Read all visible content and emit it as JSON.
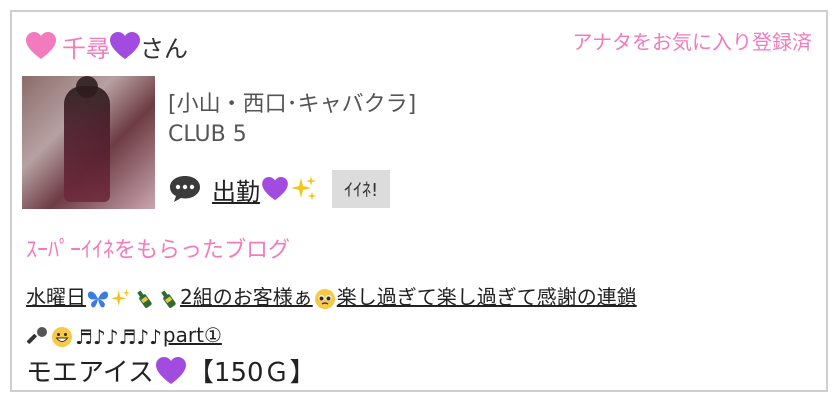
{
  "header": {
    "name": "千尋",
    "honorific": "さん",
    "favorite_status": "アナタをお気に入り登録済"
  },
  "profile": {
    "area": "[小山・西口･キャバクラ]",
    "club": "CLUB 5"
  },
  "post": {
    "title": "出勤",
    "iine_label": "ｲｲﾈ!"
  },
  "blog": {
    "heading": "ｽｰﾊﾟｰｲｲﾈをもらったブログ",
    "title_part1": "水曜日",
    "title_part2": "2組のお客様ぁ",
    "title_part3": "楽し過ぎて楽し過ぎて感謝の連鎖",
    "title_part4": "part①",
    "price_prefix": "モエアイス",
    "price_suffix": "【150Ｇ】"
  },
  "colors": {
    "accent": "#f27bbd",
    "heart_pink": "#f27bbd",
    "heart_purple": "#a24be0"
  }
}
